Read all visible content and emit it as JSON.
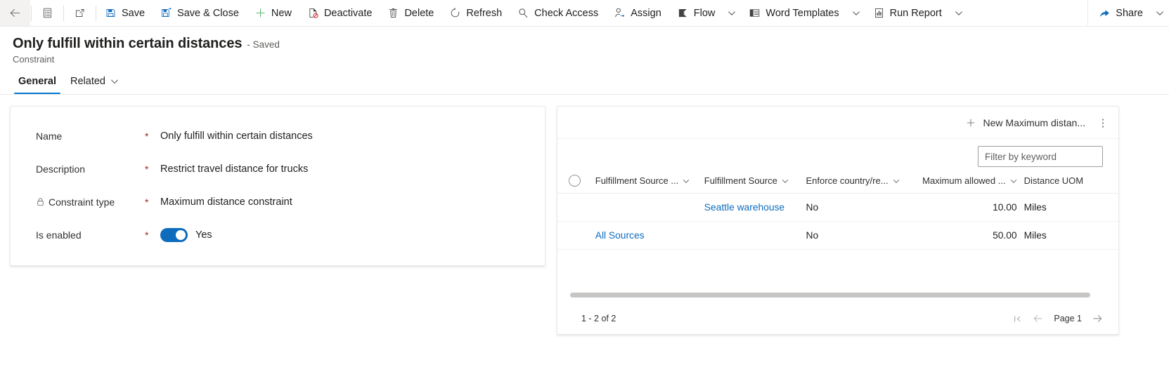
{
  "commandbar": {
    "back_label": "Back",
    "form_selector_label": "Form selector",
    "popout_label": "Open in new window",
    "buttons": [
      {
        "id": "save",
        "label": "Save",
        "icon": "save-icon"
      },
      {
        "id": "save-close",
        "label": "Save & Close",
        "icon": "save-close-icon"
      },
      {
        "id": "new",
        "label": "New",
        "icon": "plus-icon"
      },
      {
        "id": "deactivate",
        "label": "Deactivate",
        "icon": "deactivate-icon"
      },
      {
        "id": "delete",
        "label": "Delete",
        "icon": "trash-icon"
      },
      {
        "id": "refresh",
        "label": "Refresh",
        "icon": "refresh-icon"
      },
      {
        "id": "check-access",
        "label": "Check Access",
        "icon": "key-icon"
      },
      {
        "id": "assign",
        "label": "Assign",
        "icon": "person-assign-icon"
      },
      {
        "id": "flow",
        "label": "Flow",
        "icon": "flow-icon",
        "caret": true
      },
      {
        "id": "word-templates",
        "label": "Word Templates",
        "icon": "word-template-icon",
        "caret": true
      },
      {
        "id": "run-report",
        "label": "Run Report",
        "icon": "report-icon",
        "caret": true
      }
    ],
    "share": {
      "label": "Share",
      "icon": "share-icon",
      "caret": true
    }
  },
  "header": {
    "record_title": "Only fulfill within certain distances",
    "saved_state": "- Saved",
    "entity_name": "Constraint"
  },
  "tabs": [
    {
      "id": "general",
      "label": "General",
      "active": true,
      "caret": false
    },
    {
      "id": "related",
      "label": "Related",
      "active": false,
      "caret": true
    }
  ],
  "form": {
    "fields": [
      {
        "label": "Name",
        "required": "*",
        "value": "Only fulfill within certain distances",
        "locked": false
      },
      {
        "label": "Description",
        "required": "*",
        "value": "Restrict travel distance for trucks",
        "locked": false
      },
      {
        "label": "Constraint type",
        "required": "*",
        "value": "Maximum distance constraint",
        "locked": true
      },
      {
        "label": "Is enabled",
        "required": "*",
        "value": "Yes",
        "toggle": true,
        "toggle_on": true
      }
    ]
  },
  "subgrid": {
    "new_button_label": "New Maximum distan...",
    "more_button_label": "⋮",
    "filter_placeholder": "Filter by keyword",
    "columns": [
      {
        "id": "select",
        "label": "",
        "caret": false,
        "numeric": false
      },
      {
        "id": "fulfillment-source-group",
        "label": "Fulfillment Source ...",
        "caret": true,
        "numeric": false
      },
      {
        "id": "fulfillment-source",
        "label": "Fulfillment Source",
        "caret": true,
        "numeric": false
      },
      {
        "id": "enforce-country",
        "label": "Enforce country/re...",
        "caret": true,
        "numeric": false
      },
      {
        "id": "maximum-allowed",
        "label": "Maximum allowed ...",
        "caret": true,
        "numeric": true
      },
      {
        "id": "distance-uom",
        "label": "Distance UOM",
        "caret": false,
        "numeric": false
      }
    ],
    "rows": [
      {
        "fulfillment_source_group": "",
        "fulfillment_source": "Seattle warehouse",
        "fulfillment_source_link": true,
        "group_link": false,
        "enforce_country": "No",
        "maximum_allowed": "10.00",
        "distance_uom": "Miles"
      },
      {
        "fulfillment_source_group": "All Sources",
        "fulfillment_source": "",
        "fulfillment_source_link": false,
        "group_link": true,
        "enforce_country": "No",
        "maximum_allowed": "50.00",
        "distance_uom": "Miles"
      }
    ],
    "footer": {
      "record_count": "1 - 2 of 2",
      "page_label": "Page 1",
      "first_page_label": "First page",
      "prev_page_label": "Previous page",
      "next_page_label": "Next page"
    }
  },
  "colors": {
    "accent": "#0078d4",
    "link": "#0f6cbd",
    "required": "#a4262c",
    "toggle_on": "#0f6cbd"
  }
}
